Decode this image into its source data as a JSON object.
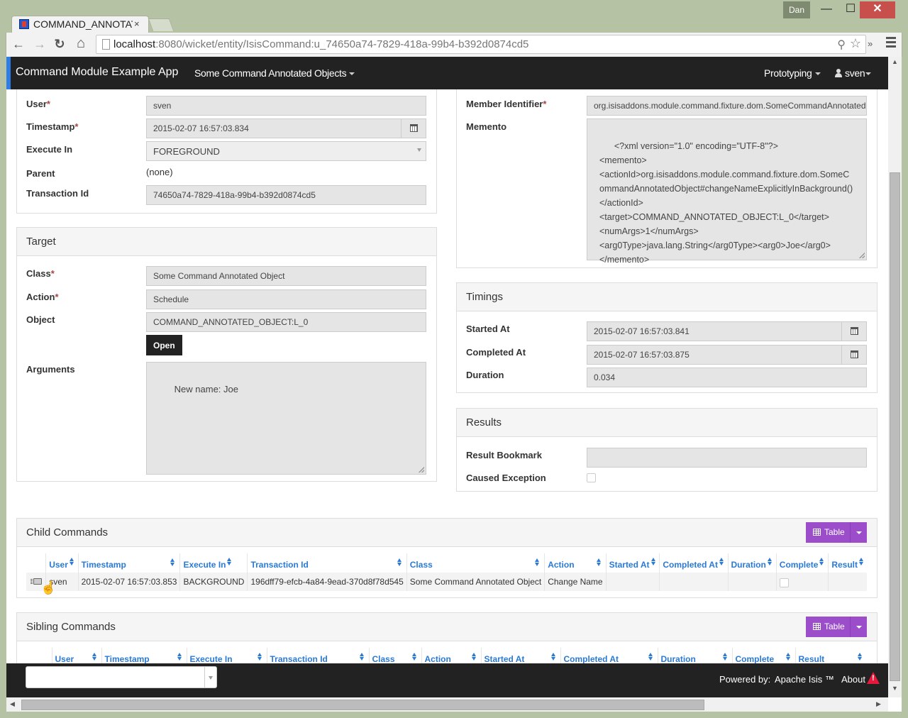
{
  "window": {
    "profile_user": "Dan",
    "minimize_icon": "minimize-icon",
    "maximize_icon": "maximize-icon",
    "close_icon": "close-icon"
  },
  "browser": {
    "tab_title": "COMMAND_ANNOTATED_OBJECT",
    "tab_close": "×",
    "url_host": "localhost",
    "url_rest": ":8080/wicket/entity/IsisCommand:u_74650a74-7829-418a-99b4-b392d0874cd5",
    "back": "←",
    "forward": "→",
    "reload": "↻",
    "home": "⌂",
    "zoom_glyph": "⚲",
    "star_glyph": "☆",
    "more_glyph": "»"
  },
  "navbar": {
    "brand": "Command Module Example App",
    "menu_objects": "Some Command Annotated Objects",
    "menu_prototyping": "Prototyping",
    "menu_user": "sven"
  },
  "command": {
    "user_label": "User",
    "user_value": "sven",
    "timestamp_label": "Timestamp",
    "timestamp_value": "2015-02-07 16:57:03.834",
    "execute_in_label": "Execute In",
    "execute_in_value": "FOREGROUND",
    "parent_label": "Parent",
    "parent_value": "(none)",
    "transaction_id_label": "Transaction Id",
    "transaction_id_value": "74650a74-7829-418a-99b4-b392d0874cd5",
    "required_mark": "*"
  },
  "target": {
    "heading": "Target",
    "class_label": "Class",
    "class_value": "Some Command Annotated Object",
    "action_label": "Action",
    "action_value": "Schedule",
    "object_label": "Object",
    "object_value": "COMMAND_ANNOTATED_OBJECT:L_0",
    "open_button": "Open",
    "arguments_label": "Arguments",
    "arguments_value": "New name: Joe"
  },
  "member": {
    "member_identifier_label": "Member Identifier",
    "member_identifier_value": "org.isisaddons.module.command.fixture.dom.SomeCommandAnnotatedObj",
    "memento_label": "Memento",
    "memento_value": "<?xml version=\"1.0\" encoding=\"UTF-8\"?>\n<memento>\n<actionId>org.isisaddons.module.command.fixture.dom.SomeCommandAnnotatedObject#changeNameExplicitlyInBackground()</actionId>\n<target>COMMAND_ANNOTATED_OBJECT:L_0</target>\n<numArgs>1</numArgs>\n<arg0Type>java.lang.String</arg0Type><arg0>Joe</arg0>\n</memento>"
  },
  "timings": {
    "heading": "Timings",
    "started_at_label": "Started At",
    "started_at_value": "2015-02-07 16:57:03.841",
    "completed_at_label": "Completed At",
    "completed_at_value": "2015-02-07 16:57:03.875",
    "duration_label": "Duration",
    "duration_value": "0.034"
  },
  "results": {
    "heading": "Results",
    "result_bookmark_label": "Result Bookmark",
    "result_bookmark_value": "",
    "caused_exception_label": "Caused Exception",
    "caused_exception_checked": false
  },
  "child_commands": {
    "heading": "Child Commands",
    "view_button": "Table",
    "columns": [
      "User",
      "Timestamp",
      "Execute In",
      "Transaction Id",
      "Class",
      "Action",
      "Started At",
      "Completed At",
      "Duration",
      "Complete",
      "Result"
    ],
    "rows": [
      {
        "user": "sven",
        "timestamp": "2015-02-07 16:57:03.853",
        "execute_in": "BACKGROUND",
        "transaction_id": "196dff79-efcb-4a84-9ead-370d8f78d545",
        "class": "Some Command Annotated Object",
        "action": "Change Name",
        "started_at": "",
        "completed_at": "",
        "duration": "",
        "complete": false,
        "result": ""
      }
    ]
  },
  "sibling_commands": {
    "heading": "Sibling Commands",
    "view_button": "Table",
    "columns": [
      "User",
      "Timestamp",
      "Execute In",
      "Transaction Id",
      "Class",
      "Action",
      "Started At",
      "Completed At",
      "Duration",
      "Complete",
      "Result"
    ]
  },
  "footer": {
    "select_value": "",
    "powered_by": "Powered by:",
    "isis_link": "Apache Isis ™",
    "about": "About"
  }
}
